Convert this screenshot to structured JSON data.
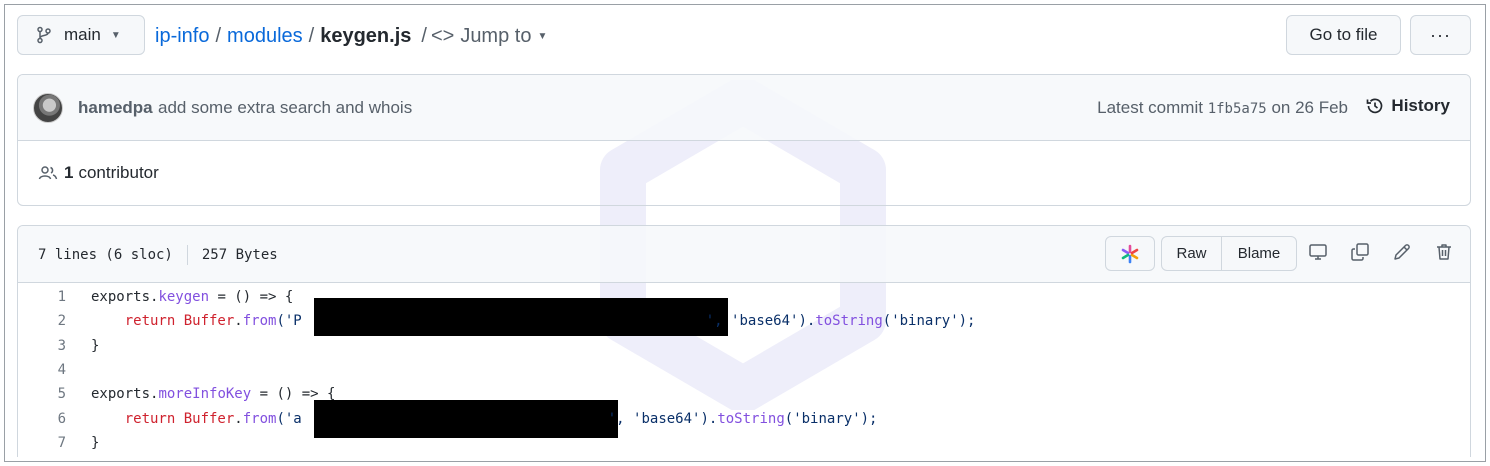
{
  "topbar": {
    "branch": "main",
    "crumbs": [
      "ip-info",
      "modules"
    ],
    "file": "keygen.js",
    "jump_label": "Jump to",
    "goto_label": "Go to file",
    "more_label": "···"
  },
  "commit": {
    "author": "hamedpa",
    "message": "add some extra search and whois",
    "latest_prefix": "Latest commit",
    "sha": "1fb5a75",
    "date": "on 26 Feb",
    "history_label": "History"
  },
  "contributors": {
    "count": "1",
    "label": "contributor"
  },
  "file": {
    "lines_info": "7 lines (6 sloc)",
    "size": "257 Bytes",
    "raw_label": "Raw",
    "blame_label": "Blame"
  },
  "code": {
    "numbers": [
      "1",
      "2",
      "3",
      "4",
      "5",
      "6",
      "7"
    ],
    "l1": {
      "a": "exports.",
      "b": "keygen",
      "c": " = () => {"
    },
    "l2": {
      "a": "    return ",
      "b": "Buffer",
      "c": ".",
      "d": "from",
      "e": "('P",
      "f": "', 'base64').",
      "g": "toString",
      "h": "('binary');"
    },
    "l3": "}",
    "l5": {
      "a": "exports.",
      "b": "moreInfoKey",
      "c": " = () => {"
    },
    "l6": {
      "a": "    return ",
      "b": "Buffer",
      "c": ".",
      "d": "from",
      "e": "('a",
      "f": "', 'base64').",
      "g": "toString",
      "h": "('binary');"
    },
    "l7": "}"
  },
  "colors": {
    "link": "#0969da",
    "keyword": "#cf222e",
    "function": "#8250df",
    "string": "#0a3069",
    "redaction": "#000000"
  }
}
